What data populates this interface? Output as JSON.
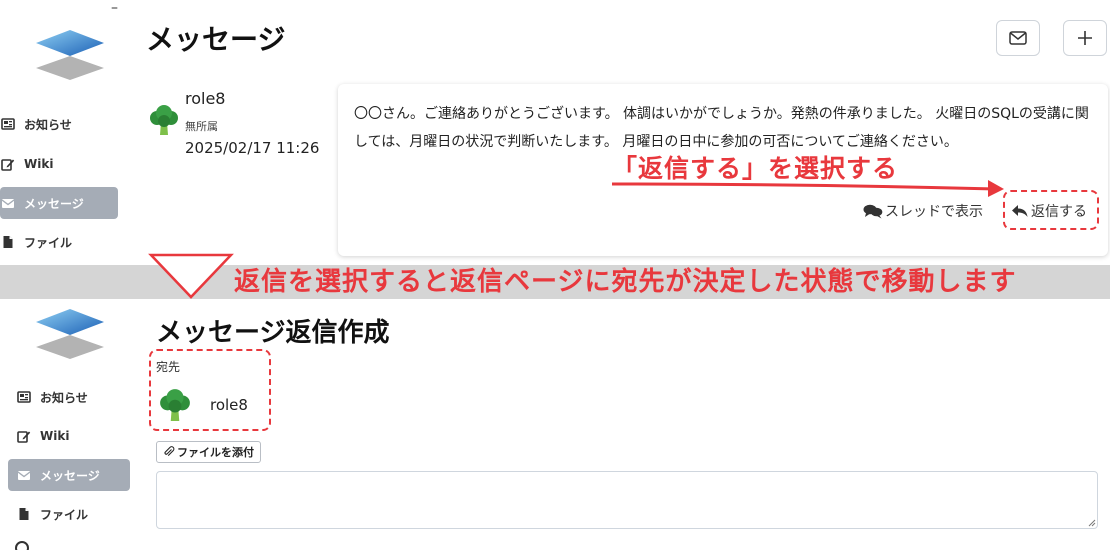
{
  "top": {
    "nav": [
      {
        "label": "お知らせ",
        "icon": "newspaper-icon"
      },
      {
        "label": "Wiki",
        "icon": "edit-icon"
      },
      {
        "label": "メッセージ",
        "icon": "envelope-icon",
        "active": true
      },
      {
        "label": "ファイル",
        "icon": "file-icon"
      }
    ],
    "title": "メッセージ",
    "sender": {
      "name": "role8",
      "group": "無所属",
      "date": "2025/02/17 11:26",
      "avatar": "broccoli-avatar"
    },
    "message_body": "〇〇さん。ご連絡ありがとうございます。 体調はいかがでしょうか。発熱の件承りました。 火曜日のSQLの受講に関しては、月曜日の状況で判断いたします。 月曜日の日中に参加の可否についてご連絡ください。",
    "thread_link": "スレッドで表示",
    "reply_link": "返信する"
  },
  "annotations": {
    "select_reply": "「返信する」を選択する",
    "band_text": "返信を選択すると返信ページに宛先が決定した状態で移動します",
    "accent_color": "#e8383d"
  },
  "bottom": {
    "nav": [
      {
        "label": "お知らせ",
        "icon": "newspaper-icon"
      },
      {
        "label": "Wiki",
        "icon": "edit-icon"
      },
      {
        "label": "メッセージ",
        "icon": "envelope-icon",
        "active": true
      },
      {
        "label": "ファイル",
        "icon": "file-icon"
      }
    ],
    "title": "メッセージ返信作成",
    "dest_label": "宛先",
    "dest_name": "role8",
    "attach_label": "ファイルを添付",
    "textarea_value": ""
  }
}
